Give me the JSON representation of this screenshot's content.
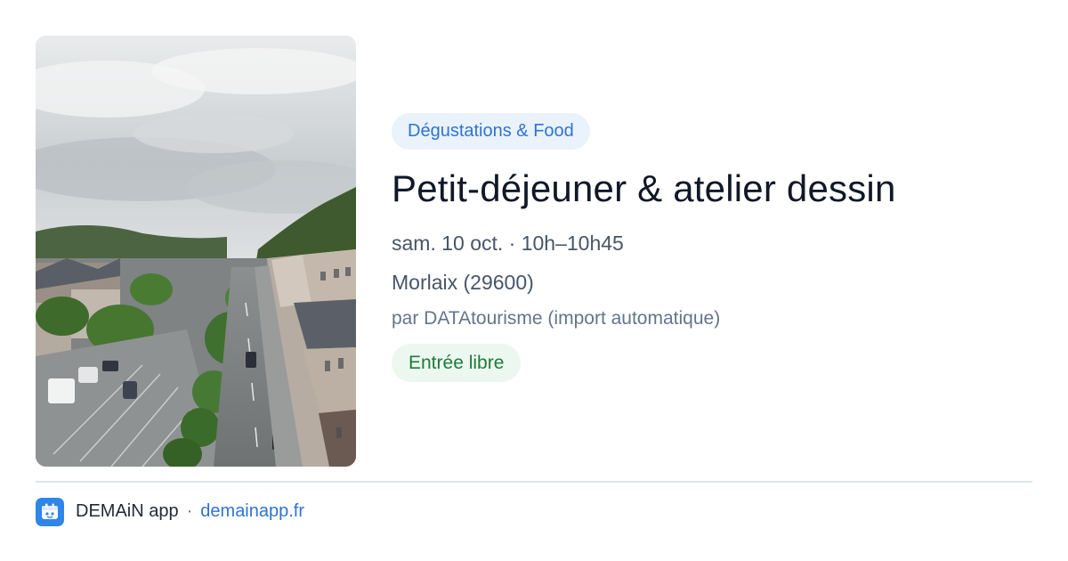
{
  "image": {
    "alt": "",
    "subject": "town-street-photo"
  },
  "event": {
    "category": "Dégustations & Food",
    "title": "Petit-déjeuner & atelier dessin",
    "datetime": "sam. 10 oct. · 10h–10h45",
    "location": "Morlaix (29600)",
    "organizer": "par DATAtourisme (import automatique)",
    "price": "Entrée libre"
  },
  "footer": {
    "logo_icon": "demain-app-logo-icon",
    "app_name": "DEMAiN app",
    "separator": "·",
    "link": "demainapp.fr"
  },
  "colors": {
    "accent": "#2f74d0",
    "category_bg": "#eaf2fc",
    "price_text": "#1d7a3c",
    "price_bg": "#ecf8ef",
    "divider": "#dbe7ee",
    "logo_bg": "#2f86e8"
  }
}
